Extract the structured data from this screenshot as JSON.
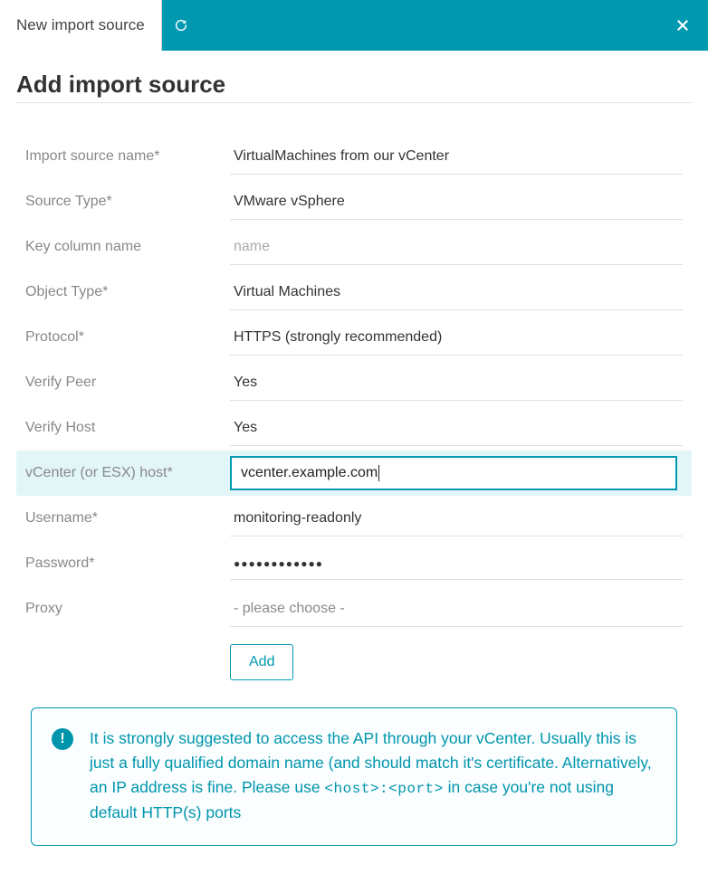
{
  "topbar": {
    "tab_label": "New import source"
  },
  "heading": "Add import source",
  "form": {
    "source_name": {
      "label": "Import source name*",
      "value": "VirtualMachines from our vCenter"
    },
    "source_type": {
      "label": "Source Type*",
      "value": "VMware vSphere"
    },
    "key_column": {
      "label": "Key column name",
      "value": "",
      "placeholder": "name"
    },
    "object_type": {
      "label": "Object Type*",
      "value": "Virtual Machines"
    },
    "protocol": {
      "label": "Protocol*",
      "value": "HTTPS (strongly recommended)"
    },
    "verify_peer": {
      "label": "Verify Peer",
      "value": "Yes"
    },
    "verify_host": {
      "label": "Verify Host",
      "value": "Yes"
    },
    "host": {
      "label": "vCenter (or ESX) host*",
      "value": "vcenter.example.com"
    },
    "username": {
      "label": "Username*",
      "value": "monitoring-readonly"
    },
    "password": {
      "label": "Password*",
      "value": "●●●●●●●●●●●●"
    },
    "proxy": {
      "label": "Proxy",
      "value": "- please choose -"
    },
    "submit_label": "Add"
  },
  "info": {
    "text_before_mono": "It is strongly suggested to access the API through your vCenter. Usually this is just a fully qualified domain name (and should match it's certificate. Alternatively, an IP address is fine. Please use ",
    "mono": "<host>:<port>",
    "text_after_mono": " in case you're not using default HTTP(s) ports"
  }
}
